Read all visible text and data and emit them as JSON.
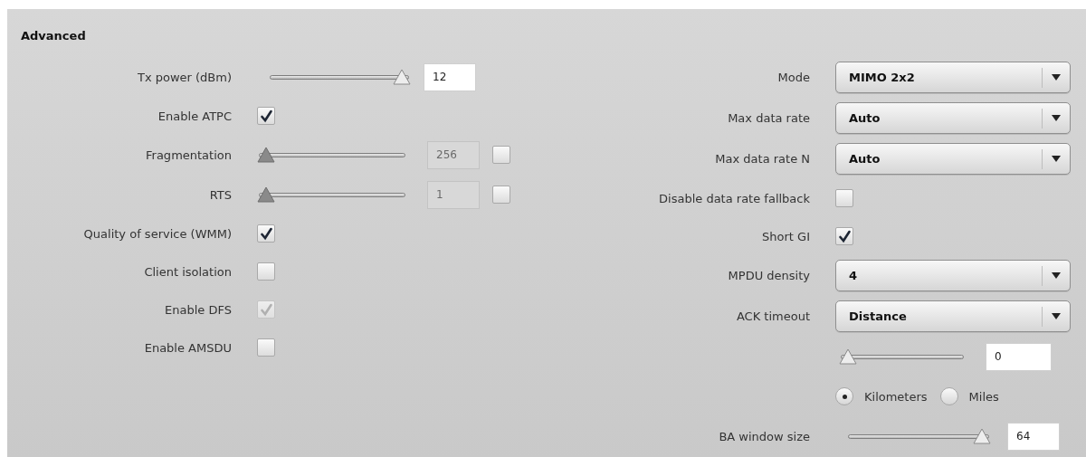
{
  "section": {
    "title": "Advanced"
  },
  "left": [
    {
      "kind": "slider",
      "label": "Tx power (dBm)",
      "level": 1,
      "value": "12",
      "disabled": false
    },
    {
      "kind": "checkbox",
      "label": "Enable ATPC",
      "checked": true,
      "disabled": false
    },
    {
      "kind": "slider",
      "label": "Fragmentation",
      "level": 0,
      "value": "256",
      "disabled": true,
      "toggle": {
        "checked": false
      }
    },
    {
      "kind": "slider",
      "label": "RTS",
      "level": 0,
      "value": "1",
      "disabled": true,
      "toggle": {
        "checked": false
      }
    },
    {
      "kind": "checkbox",
      "label": "Quality of service (WMM)",
      "checked": true,
      "disabled": false
    },
    {
      "kind": "checkbox",
      "label": "Client isolation",
      "checked": false,
      "disabled": false
    },
    {
      "kind": "checkbox",
      "label": "Enable DFS",
      "checked": true,
      "disabled": true
    },
    {
      "kind": "checkbox",
      "label": "Enable AMSDU",
      "checked": false,
      "disabled": false
    }
  ],
  "right": [
    {
      "kind": "select",
      "label": "Mode",
      "value": "MIMO 2x2"
    },
    {
      "kind": "select",
      "label": "Max data rate",
      "value": "Auto"
    },
    {
      "kind": "select",
      "label": "Max data rate N",
      "value": "Auto"
    },
    {
      "kind": "checkbox",
      "label": "Disable data rate fallback",
      "checked": false,
      "disabled": false
    },
    {
      "kind": "checkbox",
      "label": "Short GI",
      "checked": true,
      "disabled": false
    },
    {
      "kind": "select",
      "label": "MPDU density",
      "value": "4"
    },
    {
      "kind": "select",
      "label": "ACK timeout",
      "value": "Distance"
    },
    {
      "kind": "slider",
      "level": 0,
      "value": "0",
      "disabled": false
    },
    {
      "kind": "radio",
      "options": [
        {
          "label": "Kilometers",
          "selected": true
        },
        {
          "label": "Miles",
          "selected": false
        }
      ]
    },
    {
      "kind": "slider",
      "label": "BA window size",
      "level": 1,
      "value": "64",
      "disabled": false
    }
  ]
}
